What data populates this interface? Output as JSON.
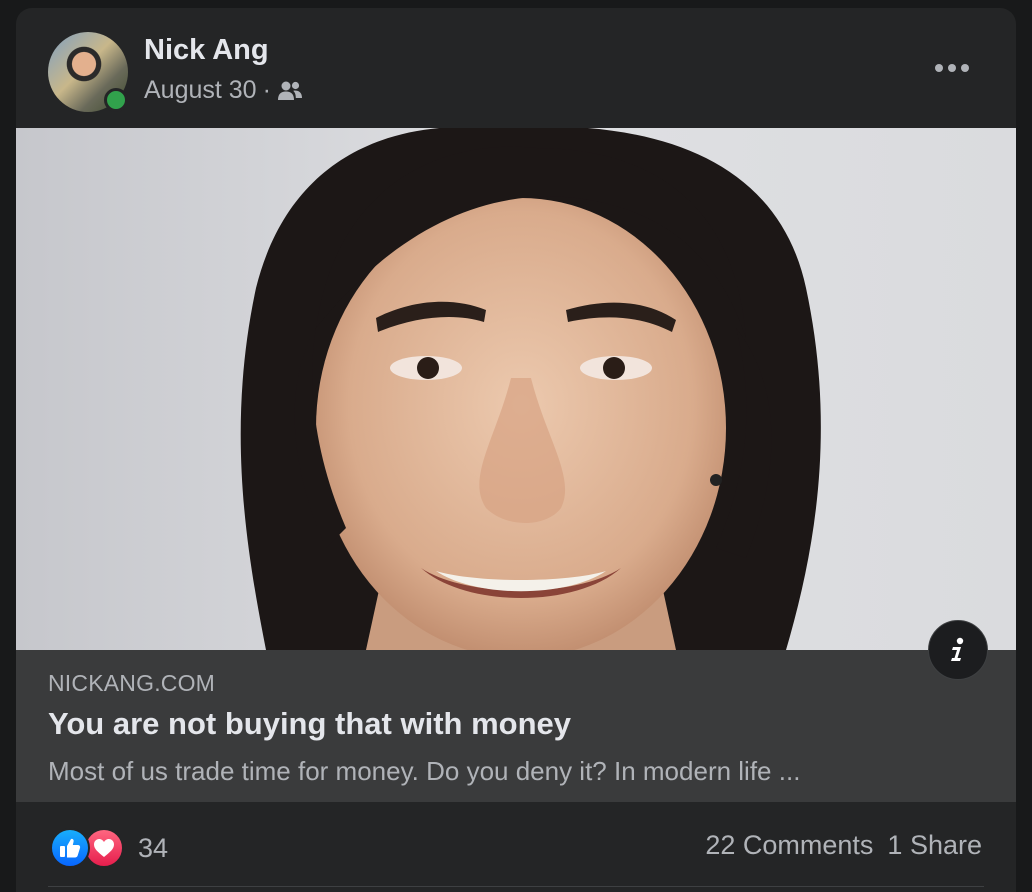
{
  "post": {
    "author": "Nick Ang",
    "date": "August 30",
    "separator": "·",
    "audience_icon": "friends-icon",
    "more_icon": "more-horizontal-icon"
  },
  "link_preview": {
    "domain": "NICKANG.COM",
    "title": "You are not buying that with money",
    "description": "Most of us trade time for money. Do you deny it? In modern life ...",
    "info_icon": "info-icon"
  },
  "engagement": {
    "reaction_icons": [
      "like-icon",
      "love-icon"
    ],
    "reaction_count": "34",
    "comments": "22 Comments",
    "shares": "1 Share"
  },
  "colors": {
    "background": "#18191a",
    "card": "#242526",
    "link_box": "#3a3b3c",
    "primary_text": "#e4e6eb",
    "secondary_text": "#b0b3b8",
    "online": "#31a24c",
    "like": "#0866ff",
    "love": "#e61e4d"
  }
}
